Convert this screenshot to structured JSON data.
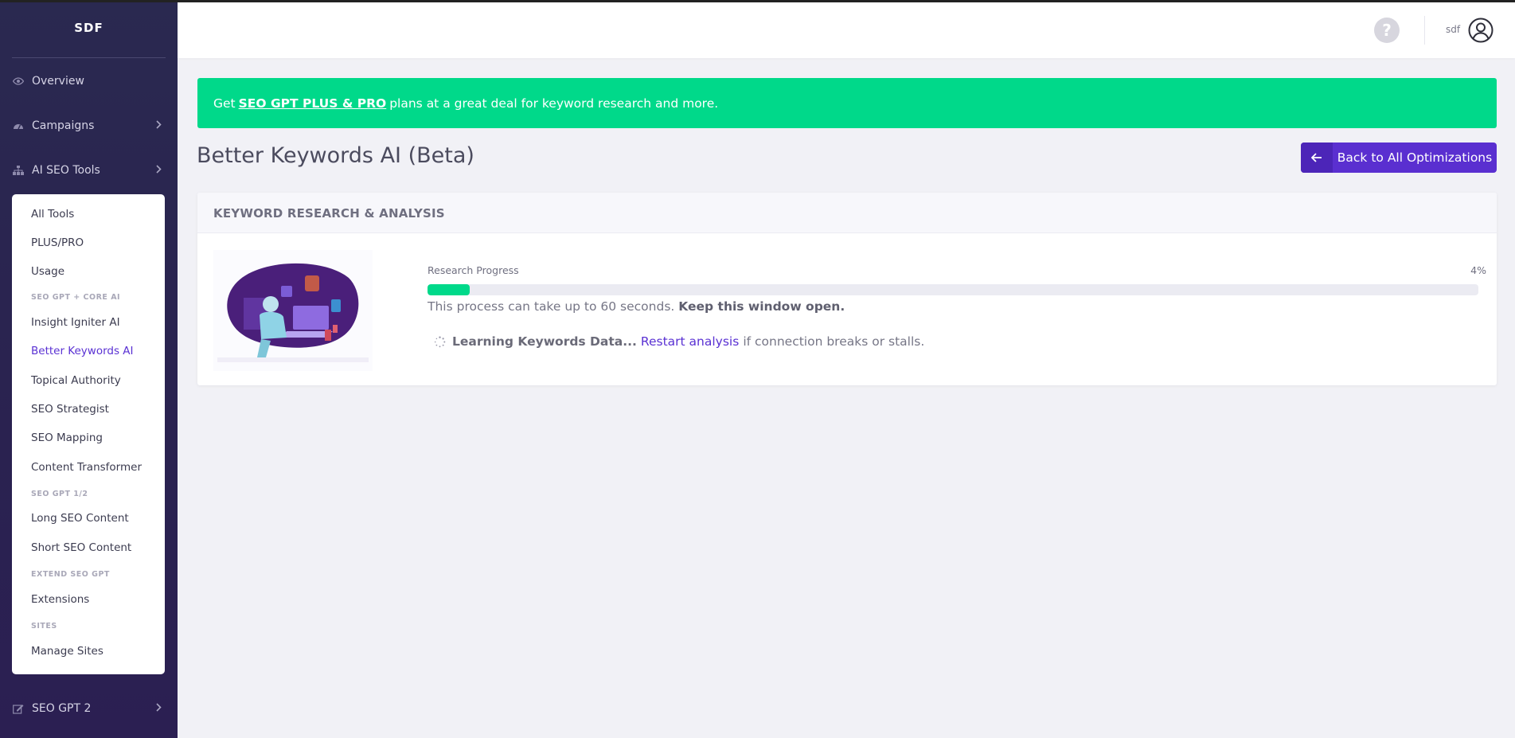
{
  "sidebar": {
    "brand": "SDF",
    "nav": [
      {
        "label": "Overview",
        "icon": "eye-icon"
      },
      {
        "label": "Campaigns",
        "icon": "gauge-icon"
      },
      {
        "label": "AI SEO Tools",
        "icon": "sitemap-icon"
      }
    ],
    "submenu": {
      "items_top": [
        "All Tools",
        "PLUS/PRO",
        "Usage"
      ],
      "section_core": "SEO GPT + CORE AI",
      "items_core": [
        "Insight Igniter AI",
        "Better Keywords AI",
        "Topical Authority",
        "SEO Strategist",
        "SEO Mapping",
        "Content Transformer"
      ],
      "section_gpt12": "SEO GPT 1/2",
      "items_gpt12": [
        "Long SEO Content",
        "Short SEO Content"
      ],
      "section_extend": "EXTEND SEO GPT",
      "items_extend": [
        "Extensions"
      ],
      "section_sites": "SITES",
      "items_sites": [
        "Manage Sites"
      ],
      "active": "Better Keywords AI"
    },
    "bottom_nav": {
      "label": "SEO GPT 2",
      "icon": "edit-icon"
    }
  },
  "header": {
    "help_glyph": "?",
    "user_name": "sdf"
  },
  "promo": {
    "prefix": "Get",
    "link": "SEO GPT PLUS & PRO",
    "suffix": "plans at a great deal for keyword research and more."
  },
  "page": {
    "title": "Better Keywords AI (Beta)",
    "back_button": "Back to All Optimizations"
  },
  "card": {
    "title": "KEYWORD RESEARCH & ANALYSIS",
    "progress_label": "Research Progress",
    "progress_text": "4%",
    "progress_value": 4,
    "note_plain": "This process can take up to 60 seconds.",
    "note_bold": "Keep this window open.",
    "status_bold": "Learning Keywords Data...",
    "restart_link": "Restart analysis",
    "status_suffix": "if connection breaks or stalls."
  },
  "colors": {
    "accent": "#5a2fd0",
    "success": "#00d98a",
    "sidebar_bg": "#2a2350"
  }
}
